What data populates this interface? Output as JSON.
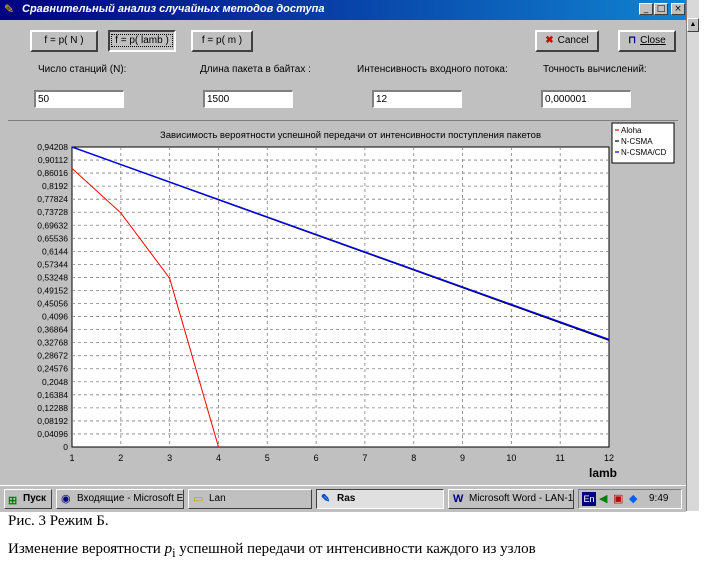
{
  "window": {
    "title": "Сравнительный анализ случайных методов доступа",
    "minimize": "_",
    "maximize": "□",
    "close": "×"
  },
  "toolbar": {
    "btn_n": "f = p( N )",
    "btn_lamb": "f = p( lamb )",
    "btn_m": "f = p( m )",
    "cancel": "Cancel",
    "close": "Close"
  },
  "params": {
    "stations_label": "Число станций (N):",
    "stations_value": "50",
    "packet_label": "Длина пакета в байтах :",
    "packet_value": "1500",
    "intensity_label": "Интенсивность входного потока:",
    "intensity_value": "12",
    "accuracy_label": "Точность вычислений:",
    "accuracy_value": "0,000001"
  },
  "chart_data": {
    "type": "line",
    "title": "Зависимость вероятности успешной передачи от интенсивности поступления пакетов",
    "xlabel": "lamb",
    "ylabel": "",
    "xlim": [
      1,
      12
    ],
    "ylim": [
      0,
      0.94208
    ],
    "x_ticks": [
      "1",
      "2",
      "3",
      "4",
      "5",
      "6",
      "7",
      "8",
      "9",
      "10",
      "11",
      "12"
    ],
    "y_ticks": [
      "0",
      "0,04096",
      "0,08192",
      "0,12288",
      "0,16384",
      "0,2048",
      "0,24576",
      "0,28672",
      "0,32768",
      "0,36864",
      "0,4096",
      "0,45056",
      "0,49152",
      "0,53248",
      "0,57344",
      "0,6144",
      "0,65536",
      "0,69632",
      "0,73728",
      "0,77824",
      "0,8192",
      "0,86016",
      "0,90112",
      "0,94208"
    ],
    "grid": true,
    "legend_position": "top-right",
    "series": [
      {
        "name": "Aloha",
        "color": "#ff0000",
        "x": [
          1,
          2,
          3,
          4
        ],
        "y": [
          0.875,
          0.735,
          0.53,
          0
        ]
      },
      {
        "name": "N-CSMA",
        "color": "#000000",
        "x": [
          1,
          12
        ],
        "y": [
          0.94208,
          0.335
        ]
      },
      {
        "name": "N-CSMA/CD",
        "color": "#0000ff",
        "x": [
          1,
          12
        ],
        "y": [
          0.94208,
          0.338
        ]
      }
    ]
  },
  "taskbar": {
    "start": "Пуск",
    "tasks": [
      {
        "label": "Входящие - Microsoft E..."
      },
      {
        "label": "Lan"
      },
      {
        "label": "Ras"
      },
      {
        "label": "Microsoft Word - LAN-1...."
      }
    ],
    "lang": "En",
    "clock": "9:49"
  },
  "caption": {
    "figure": "Рис. 3  Режим Б.",
    "desc_before": "Изменение вероятности ",
    "desc_var": "p",
    "desc_sub": "i",
    "desc_after": " успешной передачи от интенсивности каждого из узлов"
  }
}
